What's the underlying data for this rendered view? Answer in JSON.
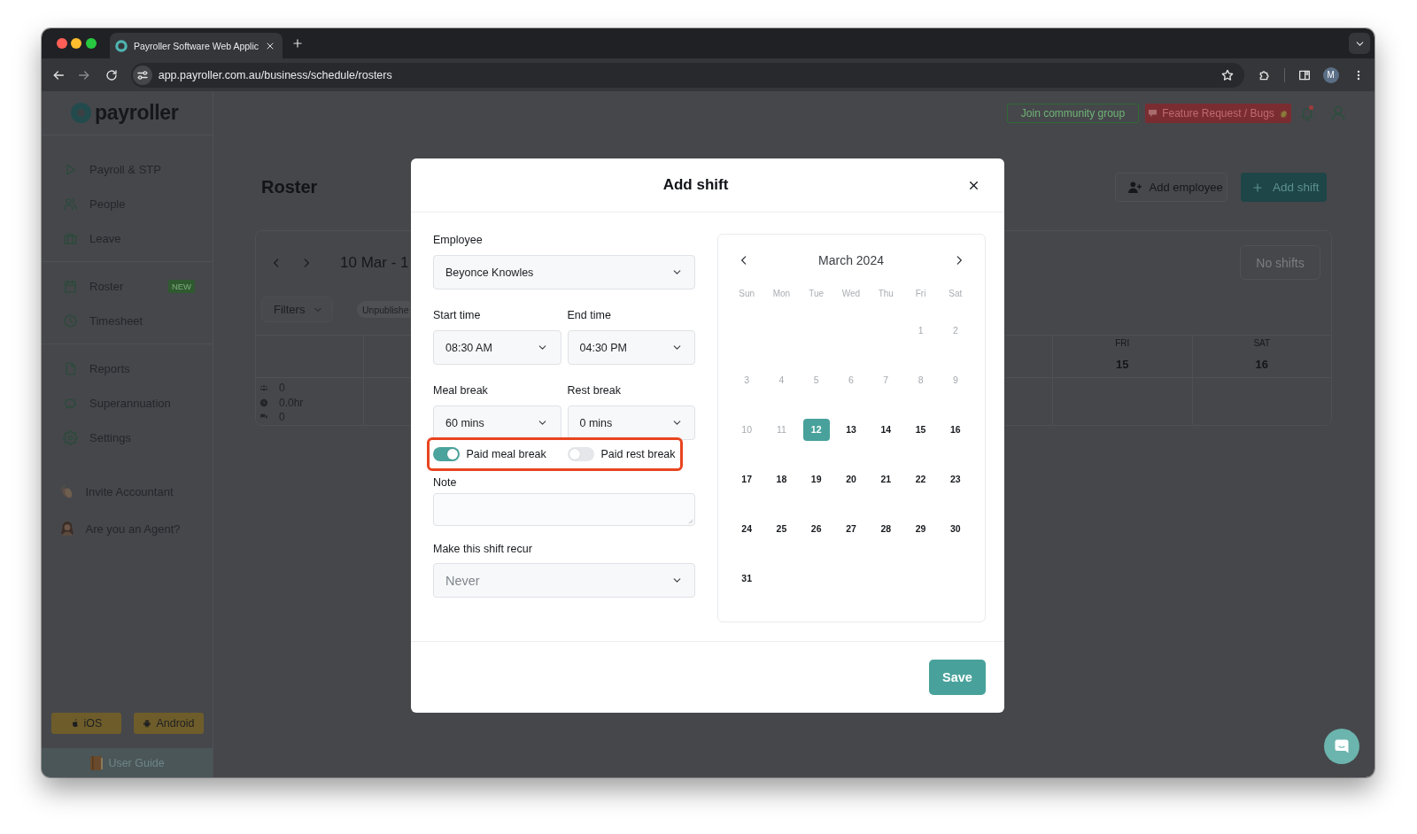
{
  "browser": {
    "tab_title": "Payroller Software Web Applic",
    "url": "app.payroller.com.au/business/schedule/rosters",
    "profile_initial": "M"
  },
  "header": {
    "logo": "payroller",
    "buttons": [
      {
        "label": "Join community group",
        "kind": "outline"
      },
      {
        "label": "Feature Request / Bugs",
        "kind": "report"
      }
    ],
    "notifications_unread": true
  },
  "sidebar": {
    "groups": [
      {
        "items": [
          {
            "label": "Payroll & STP",
            "selected": false
          },
          {
            "label": "People",
            "selected": false
          },
          {
            "label": "Leave",
            "selected": false
          }
        ]
      },
      {
        "items": [
          {
            "label": "Roster",
            "selected": false,
            "badge": "NEW"
          },
          {
            "label": "Timesheet",
            "selected": false
          }
        ]
      },
      {
        "items": [
          {
            "label": "Reports",
            "selected": false
          },
          {
            "label": "Superannuation",
            "selected": false
          },
          {
            "label": "Settings",
            "selected": false
          }
        ]
      }
    ],
    "links": [
      "Invite Accountant",
      "Are you an Agent?"
    ],
    "app_buttons": [
      "iOS",
      "Android"
    ],
    "user_guide": "User Guide"
  },
  "roster": {
    "title": "Roster",
    "actions": [
      {
        "label": "Add employee",
        "kind": "secondary"
      },
      {
        "label": "Add shift",
        "kind": "primary"
      }
    ],
    "date_range": "10 Mar - 1",
    "filters": "Filters",
    "status_chip": "Unpublishe",
    "no_shifts": {
      "label": "No shifts",
      "disabled": true
    },
    "totals": [
      "0",
      "0.0hr",
      "0"
    ],
    "days": [
      {
        "weekday": "FRI",
        "date": "15"
      },
      {
        "weekday": "SAT",
        "date": "16"
      }
    ]
  },
  "modal": {
    "title": "Add shift",
    "employee": {
      "label": "Employee",
      "value": "Beyonce Knowles"
    },
    "times": [
      {
        "label": "Start time",
        "value": "08:30 AM"
      },
      {
        "label": "End time",
        "value": "04:30 PM"
      }
    ],
    "breaks": [
      {
        "label": "Meal break",
        "value": "60 mins"
      },
      {
        "label": "Rest break",
        "value": "0 mins"
      }
    ],
    "break_toggles": {
      "highlighted": true,
      "items": [
        {
          "label": "Paid meal break",
          "on": true
        },
        {
          "label": "Paid rest break",
          "on": false
        }
      ]
    },
    "note": {
      "label": "Note"
    },
    "recur": {
      "label": "Make this shift recur",
      "placeholder": "Never"
    },
    "calendar": {
      "month": "March 2024",
      "weekdays": [
        "Sun",
        "Mon",
        "Tue",
        "Wed",
        "Thu",
        "Fri",
        "Sat"
      ],
      "weeks": [
        [
          {
            "day": "1",
            "disabled": true,
            "selected": false
          },
          {
            "day": "2",
            "disabled": true,
            "selected": false
          }
        ],
        [
          {
            "day": "3",
            "disabled": true,
            "selected": false
          },
          {
            "day": "4",
            "disabled": true,
            "selected": false
          },
          {
            "day": "5",
            "disabled": true,
            "selected": false
          },
          {
            "day": "6",
            "disabled": true,
            "selected": false
          },
          {
            "day": "7",
            "disabled": true,
            "selected": false
          },
          {
            "day": "8",
            "disabled": true,
            "selected": false
          },
          {
            "day": "9",
            "disabled": true,
            "selected": false
          }
        ],
        [
          {
            "day": "10",
            "disabled": true,
            "selected": false
          },
          {
            "day": "11",
            "disabled": true,
            "selected": false
          },
          {
            "day": "12",
            "disabled": false,
            "selected": true
          },
          {
            "day": "13",
            "disabled": false,
            "selected": false
          },
          {
            "day": "14",
            "disabled": false,
            "selected": false
          },
          {
            "day": "15",
            "disabled": false,
            "selected": false
          },
          {
            "day": "16",
            "disabled": false,
            "selected": false
          }
        ],
        [
          {
            "day": "17",
            "disabled": false,
            "selected": false
          },
          {
            "day": "18",
            "disabled": false,
            "selected": false
          },
          {
            "day": "19",
            "disabled": false,
            "selected": false
          },
          {
            "day": "20",
            "disabled": false,
            "selected": false
          },
          {
            "day": "21",
            "disabled": false,
            "selected": false
          },
          {
            "day": "22",
            "disabled": false,
            "selected": false
          },
          {
            "day": "23",
            "disabled": false,
            "selected": false
          }
        ],
        [
          {
            "day": "24",
            "disabled": false,
            "selected": false
          },
          {
            "day": "25",
            "disabled": false,
            "selected": false
          },
          {
            "day": "26",
            "disabled": false,
            "selected": false
          },
          {
            "day": "27",
            "disabled": false,
            "selected": false
          },
          {
            "day": "28",
            "disabled": false,
            "selected": false
          },
          {
            "day": "29",
            "disabled": false,
            "selected": false
          },
          {
            "day": "30",
            "disabled": false,
            "selected": false
          }
        ],
        [
          {
            "day": "31",
            "disabled": false,
            "selected": false
          }
        ]
      ]
    },
    "save": "Save"
  }
}
